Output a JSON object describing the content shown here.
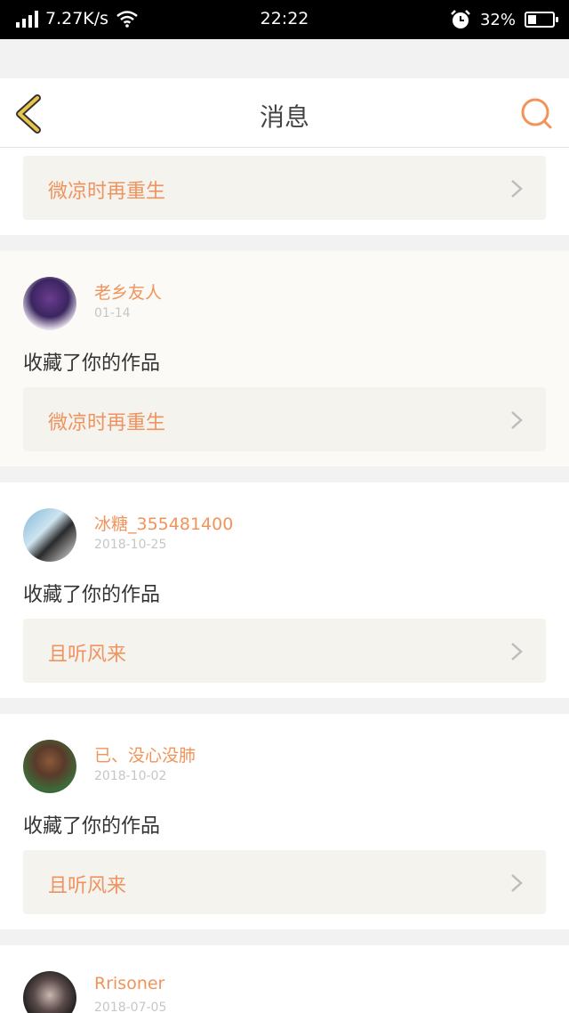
{
  "status_bar": {
    "network_speed": "7.27K/s",
    "time": "22:22",
    "battery": "32%"
  },
  "header": {
    "title": "消息"
  },
  "items": [
    {
      "work_title": "微凉时再重生"
    },
    {
      "username": "老乡友人",
      "date": "01-14",
      "action": "收藏了你的作品",
      "work_title": "微凉时再重生"
    },
    {
      "username": "冰糖_355481400",
      "date": "2018-10-25",
      "action": "收藏了你的作品",
      "work_title": "且听风来"
    },
    {
      "username": "已、没心没肺",
      "date": "2018-10-02",
      "action": "收藏了你的作品",
      "work_title": "且听风来"
    },
    {
      "username": "Rrisoner",
      "date": "2018-07-05"
    }
  ],
  "colors": {
    "accent": "#ef9360",
    "back_arrow": "#e9c54a",
    "work_bg": "#f4f3ee"
  },
  "icons": [
    "signal-icon",
    "wifi-icon",
    "alarm-icon",
    "battery-icon",
    "back-icon",
    "search-icon",
    "chevron-right-icon"
  ]
}
